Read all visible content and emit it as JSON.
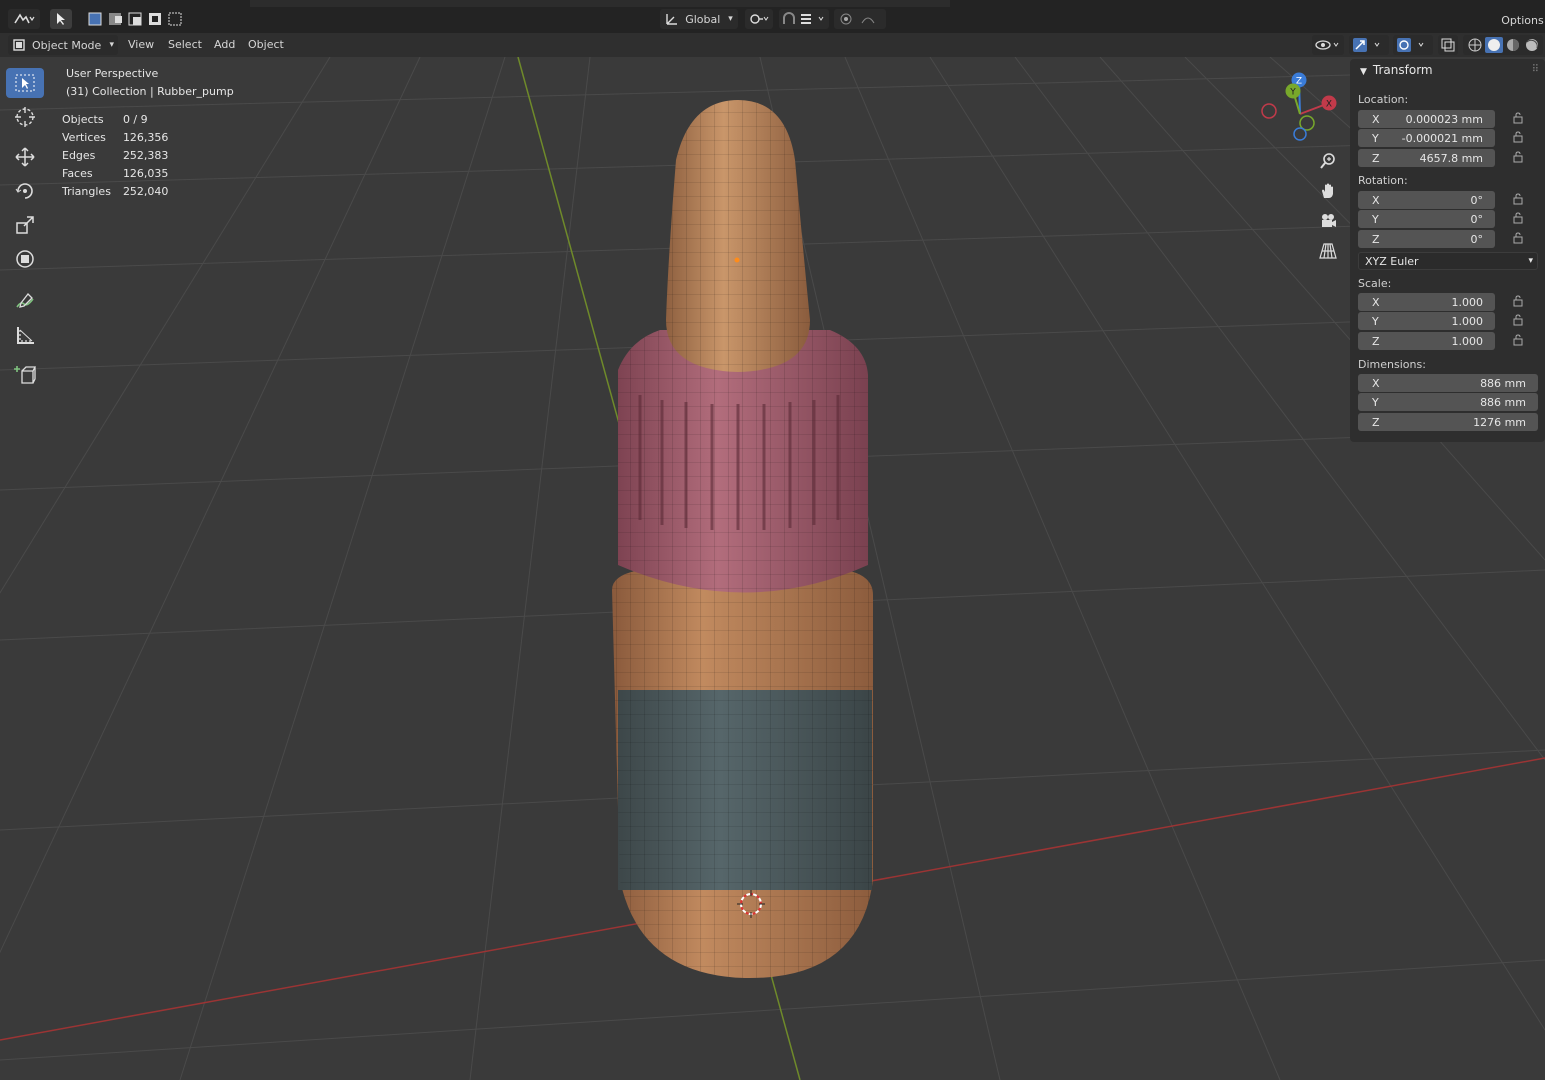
{
  "header": {
    "mode_label": "Object Mode",
    "menus": [
      "View",
      "Select",
      "Add",
      "Object"
    ],
    "orientation_label": "Global",
    "options_label": "Options"
  },
  "overlay": {
    "view_name": "User Perspective",
    "collection_label": "(31) Collection | Rubber_pump",
    "stats": [
      {
        "label": "Objects",
        "value": "0 / 9"
      },
      {
        "label": "Vertices",
        "value": "126,356"
      },
      {
        "label": "Edges",
        "value": "252,383"
      },
      {
        "label": "Faces",
        "value": "126,035"
      },
      {
        "label": "Triangles",
        "value": "252,040"
      }
    ]
  },
  "gizmo": {
    "x": "X",
    "y": "Y",
    "z": "Z"
  },
  "transform": {
    "title": "Transform",
    "location_label": "Location:",
    "location": [
      {
        "axis": "X",
        "value": "0.000023 mm"
      },
      {
        "axis": "Y",
        "value": "-0.000021 mm"
      },
      {
        "axis": "Z",
        "value": "4657.8 mm"
      }
    ],
    "rotation_label": "Rotation:",
    "rotation": [
      {
        "axis": "X",
        "value": "0°"
      },
      {
        "axis": "Y",
        "value": "0°"
      },
      {
        "axis": "Z",
        "value": "0°"
      }
    ],
    "rotation_mode": "XYZ Euler",
    "scale_label": "Scale:",
    "scale": [
      {
        "axis": "X",
        "value": "1.000"
      },
      {
        "axis": "Y",
        "value": "1.000"
      },
      {
        "axis": "Z",
        "value": "1.000"
      }
    ],
    "dimensions_label": "Dimensions:",
    "dimensions": [
      {
        "axis": "X",
        "value": "886 mm"
      },
      {
        "axis": "Y",
        "value": "886 mm"
      },
      {
        "axis": "Z",
        "value": "1276 mm"
      }
    ]
  },
  "colors": {
    "accent": "#4772b3",
    "x_axis": "#b33a3a",
    "y_axis": "#7d9a2c",
    "dropper": "#b98055",
    "cap": "#a65f6e",
    "label": "#4a5759"
  }
}
